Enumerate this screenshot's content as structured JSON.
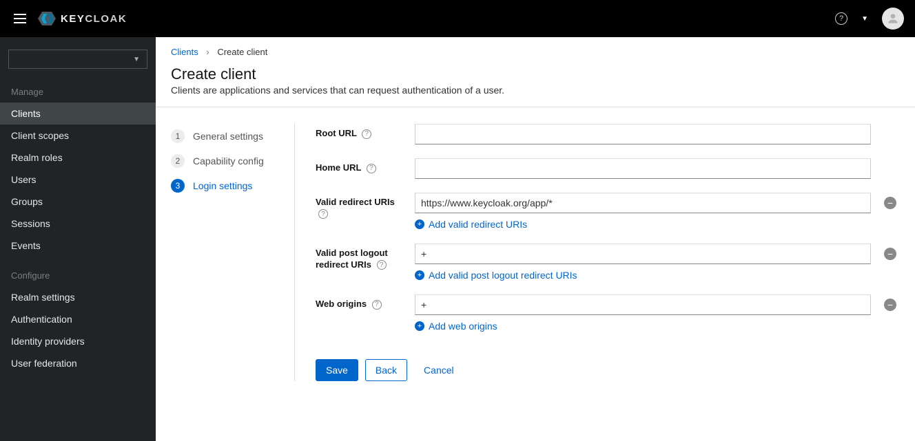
{
  "brand": {
    "name_bold": "KEY",
    "name_rest": "CLOAK"
  },
  "breadcrumb": {
    "root": "Clients",
    "current": "Create client"
  },
  "page": {
    "title": "Create client",
    "subtitle": "Clients are applications and services that can request authentication of a user."
  },
  "sidebar": {
    "sections": [
      {
        "title": "Manage",
        "items": [
          {
            "label": "Clients",
            "active": true
          },
          {
            "label": "Client scopes"
          },
          {
            "label": "Realm roles"
          },
          {
            "label": "Users"
          },
          {
            "label": "Groups"
          },
          {
            "label": "Sessions"
          },
          {
            "label": "Events"
          }
        ]
      },
      {
        "title": "Configure",
        "items": [
          {
            "label": "Realm settings"
          },
          {
            "label": "Authentication"
          },
          {
            "label": "Identity providers"
          },
          {
            "label": "User federation"
          }
        ]
      }
    ]
  },
  "wizard": {
    "steps": [
      {
        "num": "1",
        "label": "General settings"
      },
      {
        "num": "2",
        "label": "Capability config"
      },
      {
        "num": "3",
        "label": "Login settings",
        "current": true
      }
    ]
  },
  "form": {
    "root_url": {
      "label": "Root URL",
      "value": ""
    },
    "home_url": {
      "label": "Home URL",
      "value": ""
    },
    "redirect_uris": {
      "label": "Valid redirect URIs",
      "value": "https://www.keycloak.org/app/*",
      "add_label": "Add valid redirect URIs"
    },
    "post_logout": {
      "label": "Valid post logout redirect URIs",
      "value": "+",
      "add_label": "Add valid post logout redirect URIs"
    },
    "web_origins": {
      "label": "Web origins",
      "value": "+",
      "add_label": "Add web origins"
    }
  },
  "buttons": {
    "save": "Save",
    "back": "Back",
    "cancel": "Cancel"
  }
}
